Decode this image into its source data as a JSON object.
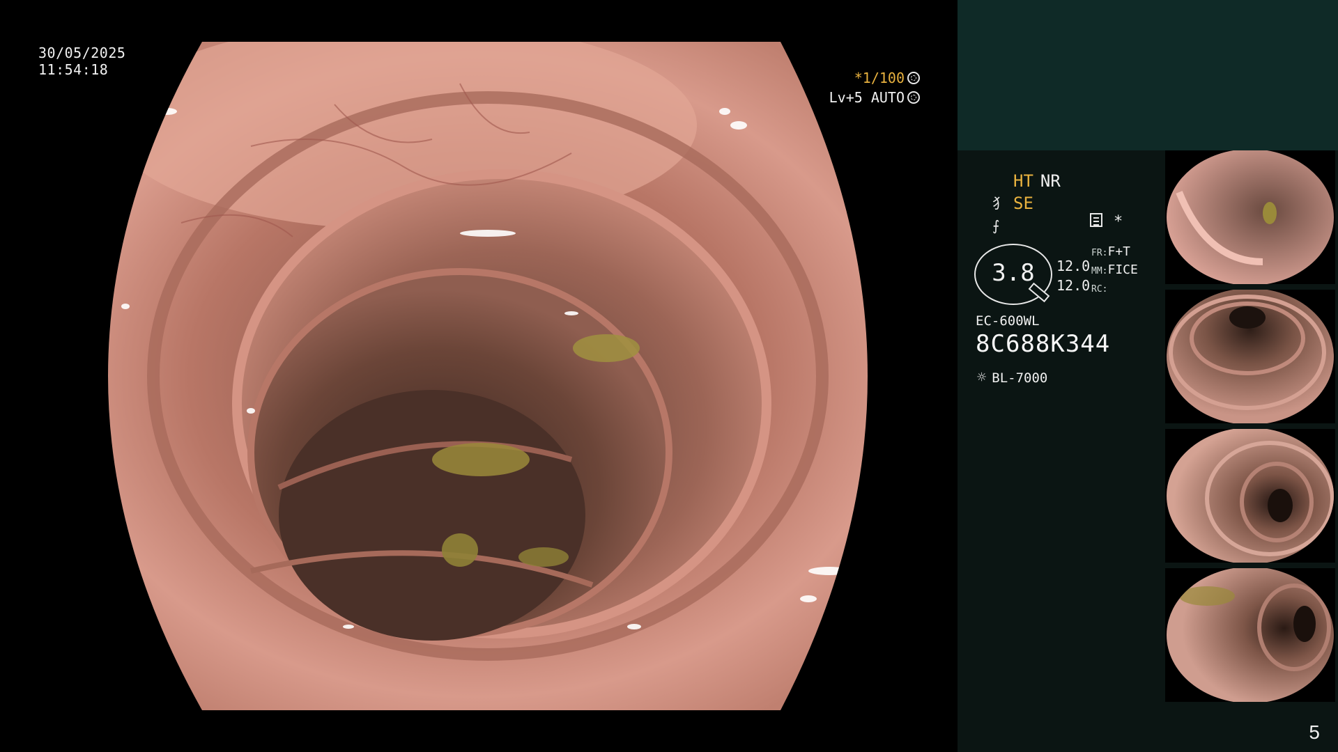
{
  "overlay": {
    "date": "30/05/2025",
    "time": "11:54:18",
    "shutter": "*1/100",
    "iris_mode": "Lv+5 AUTO",
    "shutter_icon": "shutter-icon",
    "iris_icon": "iris-icon"
  },
  "panel": {
    "mode_ht": "HT",
    "mode_nr": "NR",
    "mode_se": "SE",
    "mode_glyph_1": "⺨",
    "mode_glyph_2": "⨍",
    "star": "*",
    "zoom_value": "3.8",
    "enh_value_1": "12.0",
    "enh_value_2": "12.0",
    "fr_label": "FR:",
    "fr_value": "F+T",
    "mm_label": "MM:",
    "mm_value": "FICE",
    "rc_label": "RC:",
    "rc_value": "",
    "scope_model": "EC-600WL",
    "serial": "8C688K344",
    "light_source": "BL-7000",
    "page_number": "5"
  },
  "colors": {
    "amber": "#e9b23f",
    "panel_bg": "#0b1513",
    "panel_header_bg": "#0f2a27",
    "tissue": "#c98a7c"
  }
}
